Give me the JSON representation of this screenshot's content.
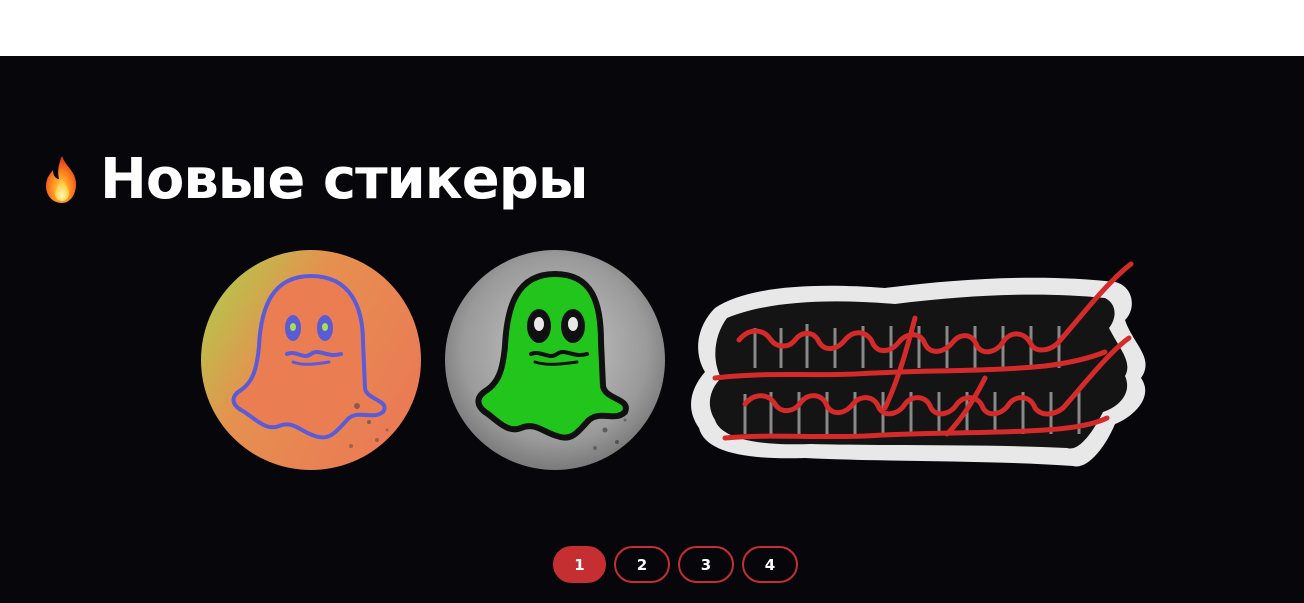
{
  "section": {
    "title": "Новые стикеры",
    "title_icon": "fire-icon"
  },
  "stickers": [
    {
      "name": "ghost-orange-sticker",
      "description_icon": "ghost-icon",
      "colors": {
        "body": "#e8794f",
        "outline": "#5a5bd8",
        "background_a": "#9fd24a",
        "background_b": "#e9835a"
      }
    },
    {
      "name": "ghost-green-sticker",
      "description_icon": "ghost-icon",
      "colors": {
        "body": "#22c51c",
        "outline": "#101010",
        "background": "#a8a8a8"
      }
    },
    {
      "name": "parental-advisory-sticker",
      "colors": {
        "blackletter": "#141414",
        "script": "#d42a2a",
        "outline": "#e8e8e8"
      }
    }
  ],
  "pagination": {
    "current": 1,
    "pages": [
      "1",
      "2",
      "3",
      "4"
    ]
  },
  "theme": {
    "background": "#07060b",
    "accent": "#c62f31",
    "text": "#ffffff"
  }
}
